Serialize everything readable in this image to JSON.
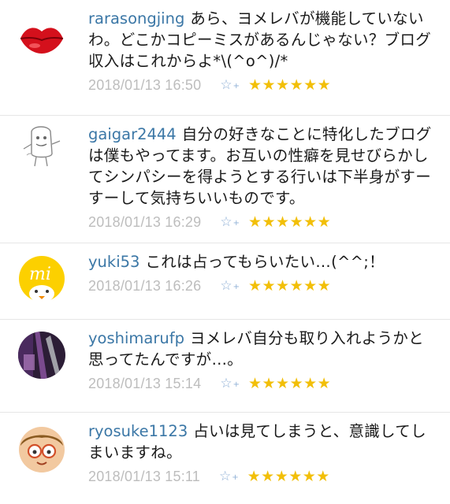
{
  "comments": [
    {
      "user": "rarasongjing",
      "text": "あら、ヨメレバが機能していないわ。どこかコピーミスがあるんじゃない？ブログ収入はこれからよ*\\(^o^)/*",
      "date": "2018/01/13 16:50",
      "add_star_icon": "star-plus-icon",
      "stars": "★★★★★★",
      "star_count": 6,
      "avatar_icon": "lips-avatar-icon"
    },
    {
      "user": "gaigar2444",
      "text": "自分の好きなことに特化したブログは僕もやってます。お互いの性癖を見せびらかしてシンパシーを得ようとする行いは下半身がすーすーして気持ちいいものです。",
      "date": "2018/01/13 16:29",
      "add_star_icon": "star-plus-icon",
      "stars": "★★★★★★",
      "star_count": 6,
      "avatar_icon": "sketch-character-avatar-icon"
    },
    {
      "user": "yuki53",
      "text": "これは占ってもらいたい…(^^;！",
      "date": "2018/01/13 16:26",
      "add_star_icon": "star-plus-icon",
      "stars": "★★★★★★",
      "star_count": 6,
      "avatar_icon": "chick-avatar-icon"
    },
    {
      "user": "yoshimarufp",
      "text": "ヨメレバ自分も取り入れようかと思ってたんですが…。",
      "date": "2018/01/13 15:14",
      "add_star_icon": "star-plus-icon",
      "stars": "★★★★★★",
      "star_count": 6,
      "avatar_icon": "photo-avatar-icon"
    },
    {
      "user": "ryosuke1123",
      "text": "占いは見てしまうと、意識してしまいますね。",
      "date": "2018/01/13 15:11",
      "add_star_icon": "star-plus-icon",
      "stars": "★★★★★★",
      "star_count": 6,
      "avatar_icon": "glasses-boy-avatar-icon"
    }
  ]
}
